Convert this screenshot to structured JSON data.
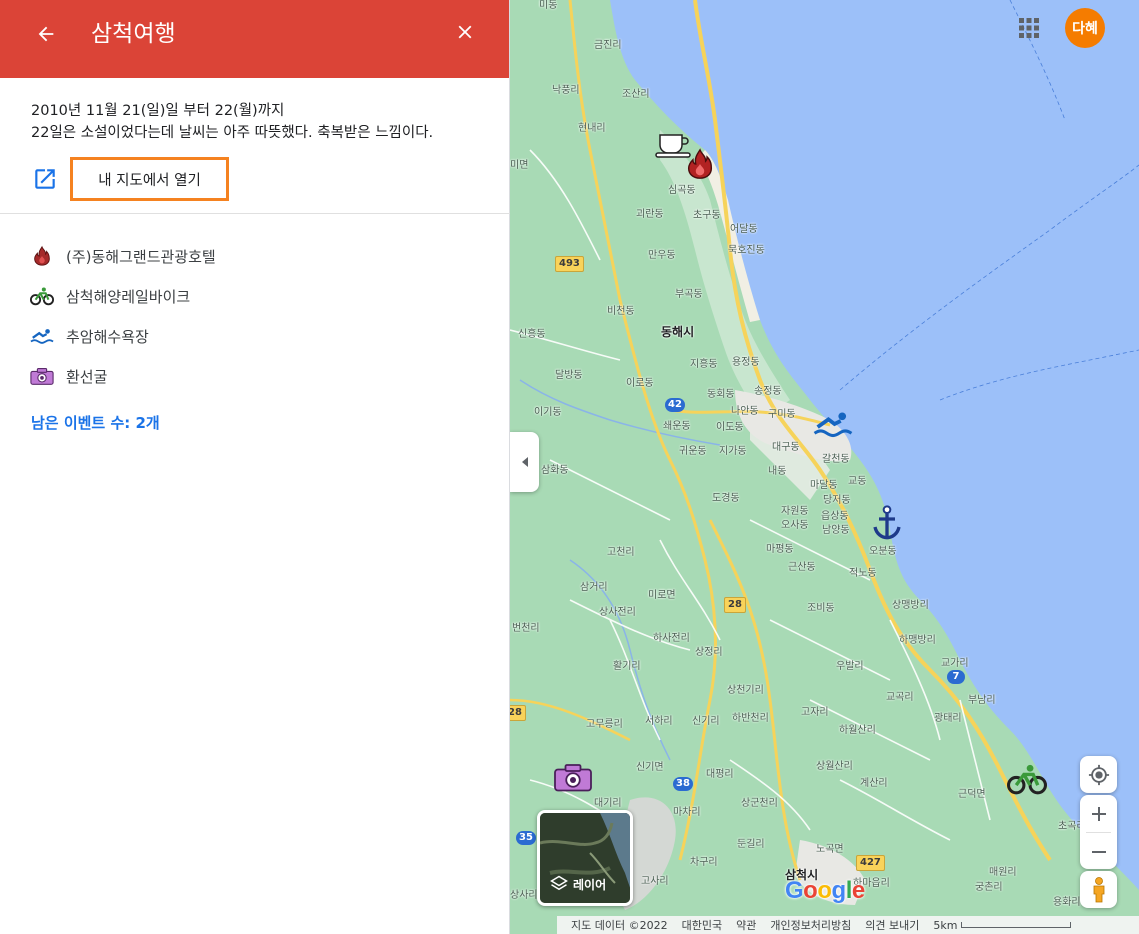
{
  "panel": {
    "title": "삼척여행",
    "description_line1": "2010년 11월 21(일)일 부터 22(월)까지",
    "description_line2": "22일은 소설이었다는데 날씨는 아주 따뜻했다. 축복받은 느낌이다.",
    "open_in_my_maps": "내 지도에서 열기",
    "places": [
      {
        "label": "(주)동해그랜드관광호텔",
        "icon": "fire-icon"
      },
      {
        "label": "삼척해양레일바이크",
        "icon": "bicycle-icon"
      },
      {
        "label": "추암해수욕장",
        "icon": "swimmer-icon"
      },
      {
        "label": "환선굴",
        "icon": "camera-icon"
      }
    ],
    "more_events": "남은 이벤트 수: 2개"
  },
  "map": {
    "labels": {
      "geumjin": "금진리",
      "naksin": "낙풍리",
      "josanri": "조산리",
      "hyeonnae": "현내리",
      "simgok": "심곡동",
      "gwanran": "괴란동",
      "chogu": "초구동",
      "eodal": "어달동",
      "mukhojin": "묵호진동",
      "manu": "만우동",
      "bukpyeong": "부곡동",
      "bicheon": "비천동",
      "donghae": "동해시",
      "sinheung": "신흥동",
      "jiheung": "지흥동",
      "yongjeong": "용정동",
      "dalbang": "달방동",
      "irodong": "이로동",
      "donghoe": "동회동",
      "songjeong": "송정동",
      "igi": "이기동",
      "naan": "나안동",
      "gumi": "구미동",
      "ssaeeun": "쇄운동",
      "ido": "이도동",
      "daegu": "대구동",
      "gwiun": "귀운동",
      "jiga": "지가동",
      "galcheon": "갈천동",
      "samhwa": "삼화동",
      "naedong": "내동",
      "madal": "마달동",
      "gyodong": "교동",
      "dodong": "도경동",
      "danggeo": "당저동",
      "jawon": "자원동",
      "eupsang": "읍상동",
      "osa": "오사동",
      "namyang": "남양동",
      "obun": "오분동",
      "gocheon": "고천리",
      "mapyeong": "마평동",
      "geunsan": "근산동",
      "jeongna": "적노동",
      "samgeo": "삼거리",
      "sangsajeon": "상사전리",
      "miro": "미로면",
      "sangmaeng": "상맹방리",
      "beoncheon": "번천리",
      "habi": "하사전리",
      "jobi": "조비동",
      "hamaeng": "하맹방리",
      "sangjeong": "상정리",
      "hwalgi": "활기리",
      "ubal": "우발리",
      "gyogari": "교가리",
      "sangcheongi": "상천기리",
      "gyogok": "교곡리",
      "bunam": "부남리",
      "gomu": "고무릉리",
      "seoha": "서하리",
      "singi": "신기리",
      "habeongi": "하반천리",
      "gojari": "고자리",
      "gwangtae": "광태리",
      "hawol": "하월산리",
      "singimyeon": "신기면",
      "daepyeong": "대평리",
      "sangwol": "상월산리",
      "gyesan": "계산리",
      "geundeok": "근덕면",
      "daegi": "대기리",
      "sanggun": "상군천리",
      "macha": "마차리",
      "chogok": "초곡리",
      "dungil": "둔길리",
      "nogok": "노곡면",
      "chagu": "차구리",
      "samcheok": "삼척시",
      "hamaeup": "하마읍리",
      "maewon": "매원리",
      "gosari": "고사리",
      "sangsa": "상사리",
      "gungchon": "궁촌리",
      "yonghwa": "용화리",
      "west_edge1": "미면",
      "west_edge2": "미동"
    },
    "shields": {
      "r493": "493",
      "r42": "42",
      "r28": "28",
      "r7": "7",
      "r38": "38",
      "r35": "35",
      "r427": "427",
      "r_edge": "28"
    },
    "account_initials": "다혜",
    "layer_label": "레이어",
    "google_logo": "Google",
    "footer": {
      "map_data": "지도 데이터 ©2022",
      "country": "대한민국",
      "terms": "약관",
      "privacy": "개인정보처리방침",
      "feedback": "의견 보내기",
      "scale": "5km"
    }
  },
  "colors": {
    "header": "#db4437",
    "highlight_border": "#f58220",
    "link": "#1a73e8",
    "sea": "#9cc0f9",
    "land": "#a8dab5",
    "avatar": "#f57c00"
  }
}
